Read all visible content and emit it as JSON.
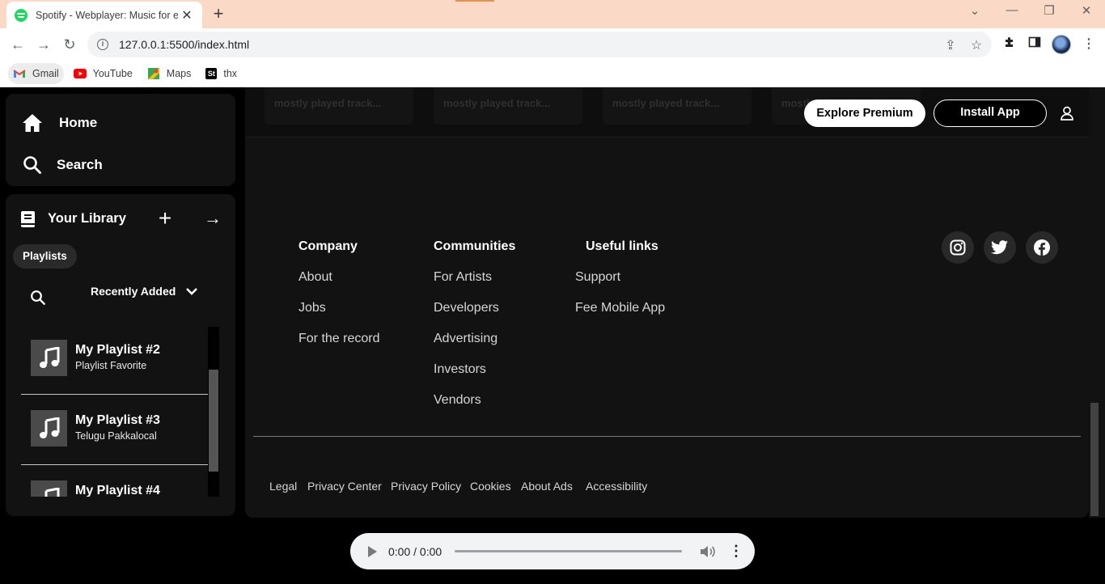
{
  "browser": {
    "tab_title": "Spotify - Webplayer: Music for ev",
    "tab_close": "✕",
    "new_tab": "+",
    "url": "127.0.0.1:5500/index.html",
    "bookmarks": [
      {
        "label": "Gmail"
      },
      {
        "label": "YouTube"
      },
      {
        "label": "Maps"
      },
      {
        "label": "thx",
        "badge": "St"
      }
    ]
  },
  "sidebar": {
    "nav": [
      {
        "label": "Home",
        "icon": "home-icon"
      },
      {
        "label": "Search",
        "icon": "search-icon"
      }
    ],
    "library": {
      "title": "Your Library",
      "add": "+",
      "expand": "→",
      "chip": "Playlists",
      "sort_label": "Recently Added",
      "playlists": [
        {
          "name": "My Playlist #2",
          "subtitle": "Playlist Favorite"
        },
        {
          "name": "My Playlist #3",
          "subtitle": "Telugu Pakkalocal"
        },
        {
          "name": "My Playlist #4",
          "subtitle": ""
        }
      ]
    }
  },
  "header": {
    "ghost_cards": [
      "mostly played track...",
      "mostly played track...",
      "mostly played track...",
      "mostly played track..."
    ],
    "explore_premium": "Explore Premium",
    "install_app": "Install App"
  },
  "footer": {
    "columns": [
      {
        "title": "Company",
        "links": [
          "About",
          "Jobs",
          "For the record"
        ]
      },
      {
        "title": "Communities",
        "links": [
          "For Artists",
          "Developers",
          "Advertising",
          "Investors",
          "Vendors"
        ]
      },
      {
        "title": "Useful links",
        "links": [
          "Support",
          "Fee Mobile App"
        ]
      }
    ],
    "social": [
      "instagram-icon",
      "twitter-icon",
      "facebook-icon"
    ],
    "legal": [
      "Legal",
      "Privacy Center",
      "Privacy Policy",
      "Cookies",
      "About Ads",
      "Accessibility"
    ]
  },
  "player": {
    "time": "0:00 / 0:00",
    "more": "⋮"
  }
}
